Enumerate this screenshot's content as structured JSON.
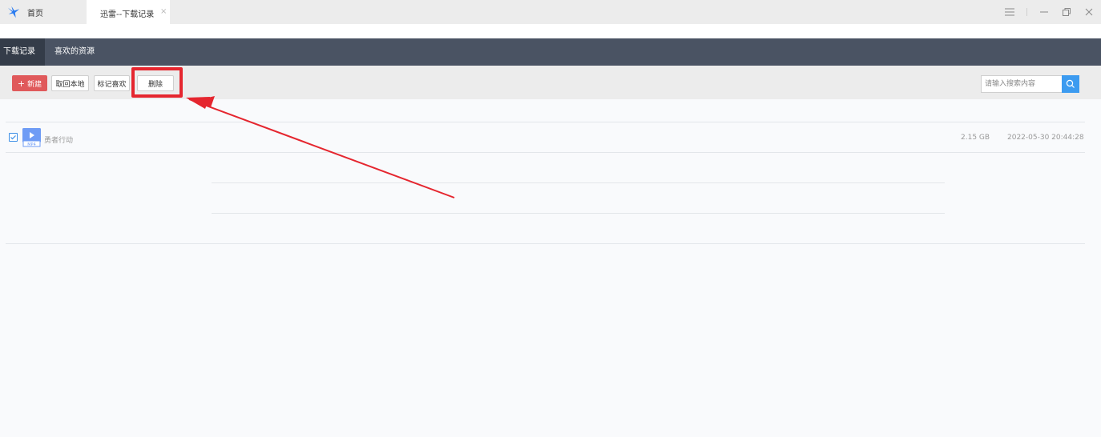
{
  "titlebar": {
    "home_tab_label": "首页",
    "active_tab_label": "迅雷--下载记录",
    "close_glyph": "×"
  },
  "nav": {
    "items": [
      {
        "label": "下载记录",
        "active": true
      },
      {
        "label": "喜欢的资源",
        "active": false
      }
    ]
  },
  "toolbar": {
    "new_label": "新建",
    "cancel_local_label": "取回本地",
    "mark_fav_label": "标记喜欢",
    "delete_label": "删除"
  },
  "search": {
    "placeholder": "请输入搜索内容"
  },
  "files": [
    {
      "name": "勇者行动",
      "size": "2.15 GB",
      "date": "2022-05-30 20:44:28",
      "type_label": "MP4",
      "checked": true
    }
  ],
  "colors": {
    "nav_bg": "#4a5363",
    "nav_active_bg": "#343c49",
    "new_button": "#e0595b",
    "search_button": "#3c9bf0",
    "annotation": "#e5262f"
  },
  "icons": {
    "logo": "xunlei-bird-icon",
    "search": "search-icon",
    "menu": "menu-icon",
    "minimize": "minimize-icon",
    "restore": "restore-icon",
    "close": "close-icon",
    "checkbox": "checkbox-checked-icon",
    "file": "mp4-file-icon"
  }
}
